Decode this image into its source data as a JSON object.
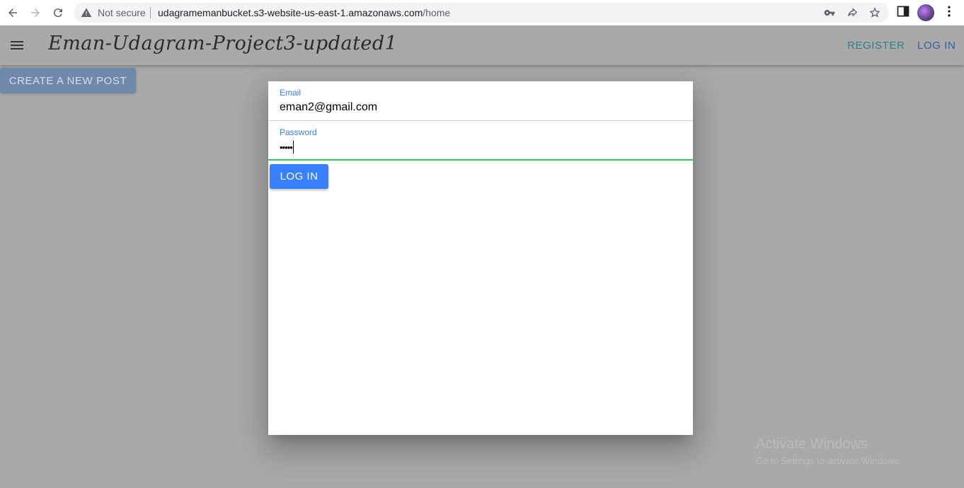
{
  "browser": {
    "security_label": "Not secure",
    "url_host": "udagramemanbucket.s3-website-us-east-1.amazonaws.com",
    "url_path": "/home"
  },
  "toolbar": {
    "title": "Eman-Udagram-Project3-updated1",
    "register_label": "REGISTER",
    "login_label": "LOG IN"
  },
  "create_post_label": "CREATE A NEW POST",
  "login_modal": {
    "email_label": "Email",
    "email_value": "eman2@gmail.com",
    "password_label": "Password",
    "password_masked": "•••••",
    "submit_label": "LOG IN",
    "accent_color": "#3880ff",
    "valid_color": "#2dcf5a"
  },
  "watermark": {
    "title": "Activate Windows",
    "subtitle": "Go to Settings to activate Windows."
  }
}
